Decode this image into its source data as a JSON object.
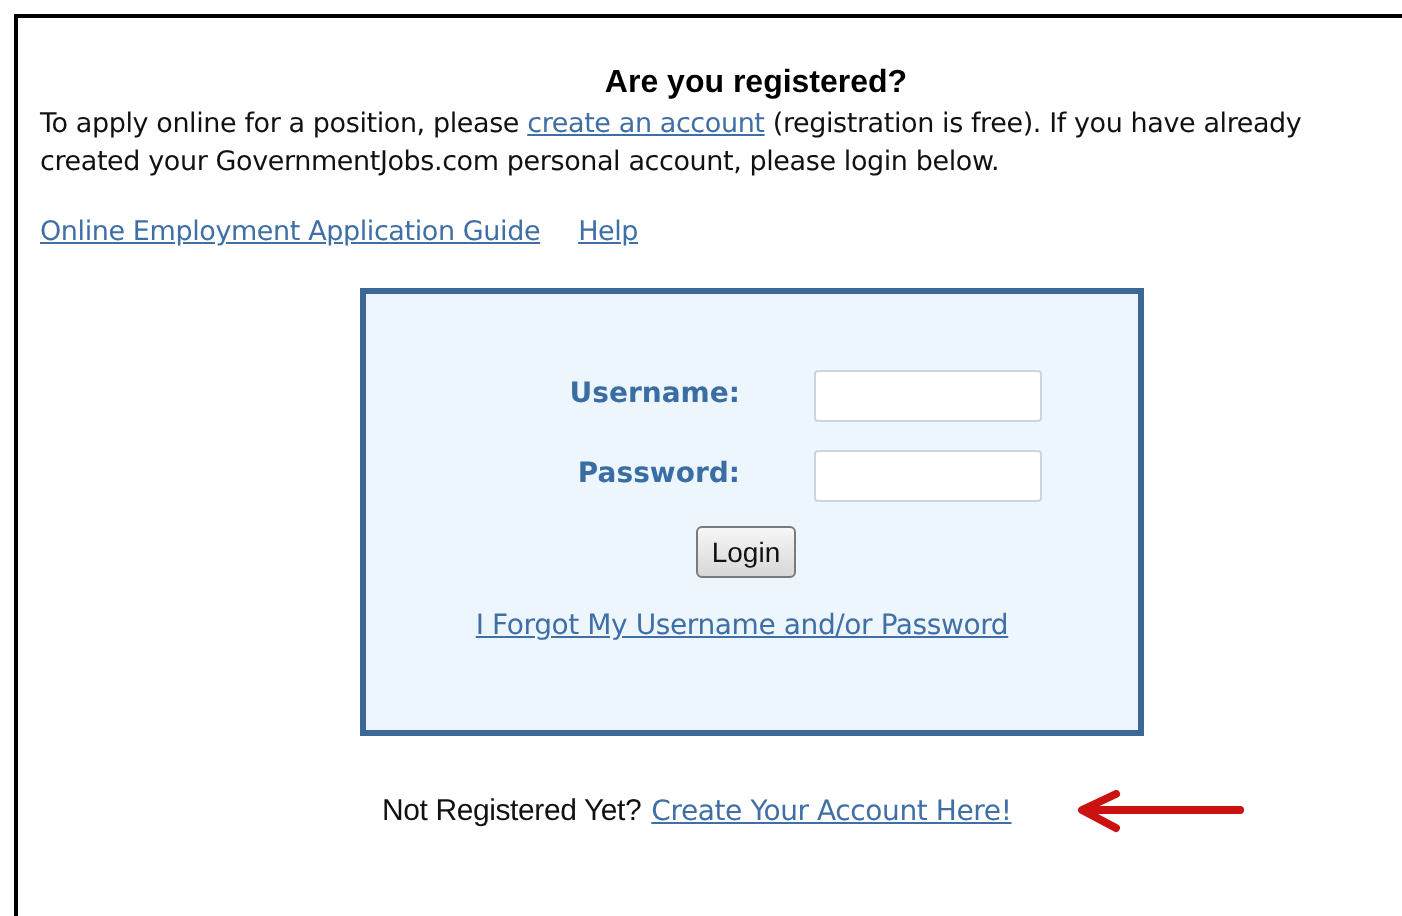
{
  "heading": "Are you registered?",
  "intro": {
    "before": "To apply online for a position, please",
    "link": "create an account",
    "after": "(registration is free). If you have already created your GovernmentJobs.com personal account, please login below."
  },
  "links": [
    "Online Employment Application Guide",
    "Help"
  ],
  "login_form": {
    "fields": [
      {
        "label": "Username:"
      },
      {
        "label": "Password:"
      }
    ],
    "button": "Login",
    "forgot_link": "I Forgot My Username and/or Password"
  },
  "register": {
    "text": "Not Registered Yet?",
    "link": "Create Your Account Here!"
  }
}
